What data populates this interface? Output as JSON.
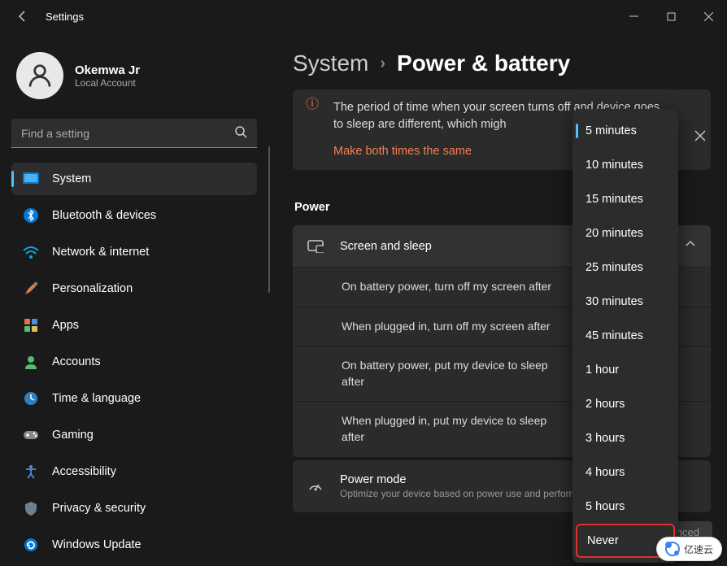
{
  "titlebar": {
    "title": "Settings"
  },
  "user": {
    "name": "Okemwa Jr",
    "account": "Local Account"
  },
  "search": {
    "placeholder": "Find a setting"
  },
  "nav": [
    {
      "label": "System",
      "icon": "system",
      "active": true
    },
    {
      "label": "Bluetooth & devices",
      "icon": "bluetooth"
    },
    {
      "label": "Network & internet",
      "icon": "network"
    },
    {
      "label": "Personalization",
      "icon": "personalization"
    },
    {
      "label": "Apps",
      "icon": "apps"
    },
    {
      "label": "Accounts",
      "icon": "accounts"
    },
    {
      "label": "Time & language",
      "icon": "time"
    },
    {
      "label": "Gaming",
      "icon": "gaming"
    },
    {
      "label": "Accessibility",
      "icon": "accessibility"
    },
    {
      "label": "Privacy & security",
      "icon": "privacy"
    },
    {
      "label": "Windows Update",
      "icon": "update"
    }
  ],
  "breadcrumb": {
    "parent": "System",
    "current": "Power & battery"
  },
  "banner": {
    "text": "The period of time when your screen turns off and device goes to sleep are different, which migh",
    "link": "Make both times the same"
  },
  "power": {
    "section": "Power",
    "screen_sleep": "Screen and sleep",
    "rows": [
      "On battery power, turn off my screen after",
      "When plugged in, turn off my screen after",
      "On battery power, put my device to sleep after",
      "When plugged in, put my device to sleep after"
    ],
    "powermode": {
      "title": "Power mode",
      "sub": "Optimize your device based on power use and performance"
    }
  },
  "dropdown": {
    "options": [
      "5 minutes",
      "10 minutes",
      "15 minutes",
      "20 minutes",
      "25 minutes",
      "30 minutes",
      "45 minutes",
      "1 hour",
      "2 hours",
      "3 hours",
      "4 hours",
      "5 hours",
      "Never"
    ],
    "selected": "5 minutes",
    "highlighted": "Never"
  },
  "balanced_btn": "Balanced",
  "watermark": "亿速云"
}
